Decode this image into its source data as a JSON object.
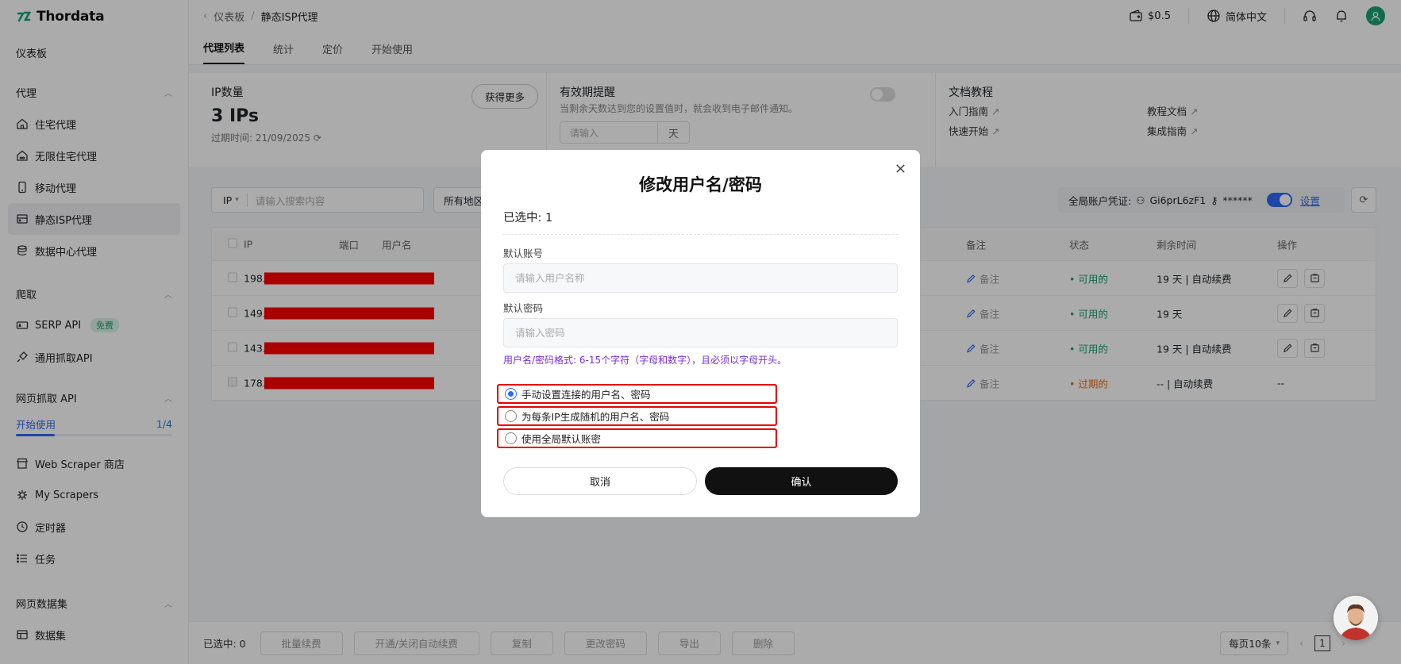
{
  "app": {
    "name": "Thordata"
  },
  "sidebar": {
    "dashboard": "仪表板",
    "proxy_section": "代理",
    "proxy_items": [
      "住宅代理",
      "无限住宅代理",
      "移动代理",
      "静态ISP代理",
      "数据中心代理"
    ],
    "active_item": "静态ISP代理",
    "scrape_section": "爬取",
    "serp_api": "SERP API",
    "serp_badge": "免费",
    "general_api": "通用抓取API",
    "webapi_section": "网页抓取 API",
    "start_label": "开始使用",
    "start_progress": "1/4",
    "start_progress_fraction": 0.25,
    "web_items": [
      "Web Scraper 商店",
      "My Scrapers",
      "定时器",
      "任务"
    ],
    "dataset_section": "网页数据集",
    "dataset_item": "数据集"
  },
  "topbar": {
    "breadcrumb_parent": "仪表板",
    "breadcrumb_sep": "/",
    "breadcrumb_current": "静态ISP代理",
    "balance": "$0.5",
    "language": "简体中文"
  },
  "tabs": [
    "代理列表",
    "统计",
    "定价",
    "开始使用"
  ],
  "cards": {
    "ip_title": "IP数量",
    "ip_count": "3 IPs",
    "expiry": "过期时间: 21/09/2025",
    "get_more": "获得更多",
    "reminder_title": "有效期提醒",
    "reminder_sub": "当剩余天数达到您的设置值时，就会收到电子邮件通知。",
    "reminder_placeholder": "请输入",
    "reminder_unit": "天",
    "docs_title": "文档教程",
    "docs": [
      "入门指南",
      "教程文档",
      "快速开始",
      "集成指南"
    ]
  },
  "search": {
    "type": "IP",
    "placeholder": "请输入搜索内容",
    "region": "所有地区"
  },
  "credentials": {
    "label": "全局账户凭证:",
    "user": "Gi6prL6zF1",
    "password": "******",
    "settings": "设置"
  },
  "table": {
    "headers": {
      "ip": "IP",
      "port": "端口",
      "username": "用户名",
      "note": "备注",
      "status": "状态",
      "remaining": "剩余时间",
      "actions": "操作"
    },
    "rows": [
      {
        "ip": "198.",
        "note": "备注",
        "status": "可用的",
        "remaining": "19 天 | 自动续费"
      },
      {
        "ip": "149.",
        "note": "备注",
        "status": "可用的",
        "remaining": "19 天"
      },
      {
        "ip": "143.",
        "note": "备注",
        "status": "可用的",
        "remaining": "19 天 | 自动续费"
      },
      {
        "ip": "178.",
        "note": "备注",
        "status": "过期的",
        "remaining": "-- | 自动续费",
        "actions": "--"
      }
    ]
  },
  "bottombar": {
    "selected": "已选中: 0",
    "buttons": [
      "批量续费",
      "开通/关闭自动续费",
      "复制",
      "更改密码",
      "导出",
      "删除"
    ],
    "page_size": "每页10条",
    "page": "1"
  },
  "modal": {
    "title": "修改用户名/密码",
    "selected": "已选中: 1",
    "user_label": "默认账号",
    "user_placeholder": "请输入用户名称",
    "pass_label": "默认密码",
    "pass_placeholder": "请输入密码",
    "hint": "用户名/密码格式: 6-15个字符（字母和数字），且必须以字母开头。",
    "options": [
      "手动设置连接的用户名、密码",
      "为每条IP生成随机的用户名、密码",
      "使用全局默认账密"
    ],
    "selected_option": 0,
    "cancel": "取消",
    "confirm": "确认"
  },
  "colors": {
    "brand": "#1aa37a",
    "accent": "#2e6bf6",
    "ok": "#16a070",
    "expired": "#e06a1a",
    "highlight": "#e60000",
    "hint": "#7a2fd6"
  }
}
